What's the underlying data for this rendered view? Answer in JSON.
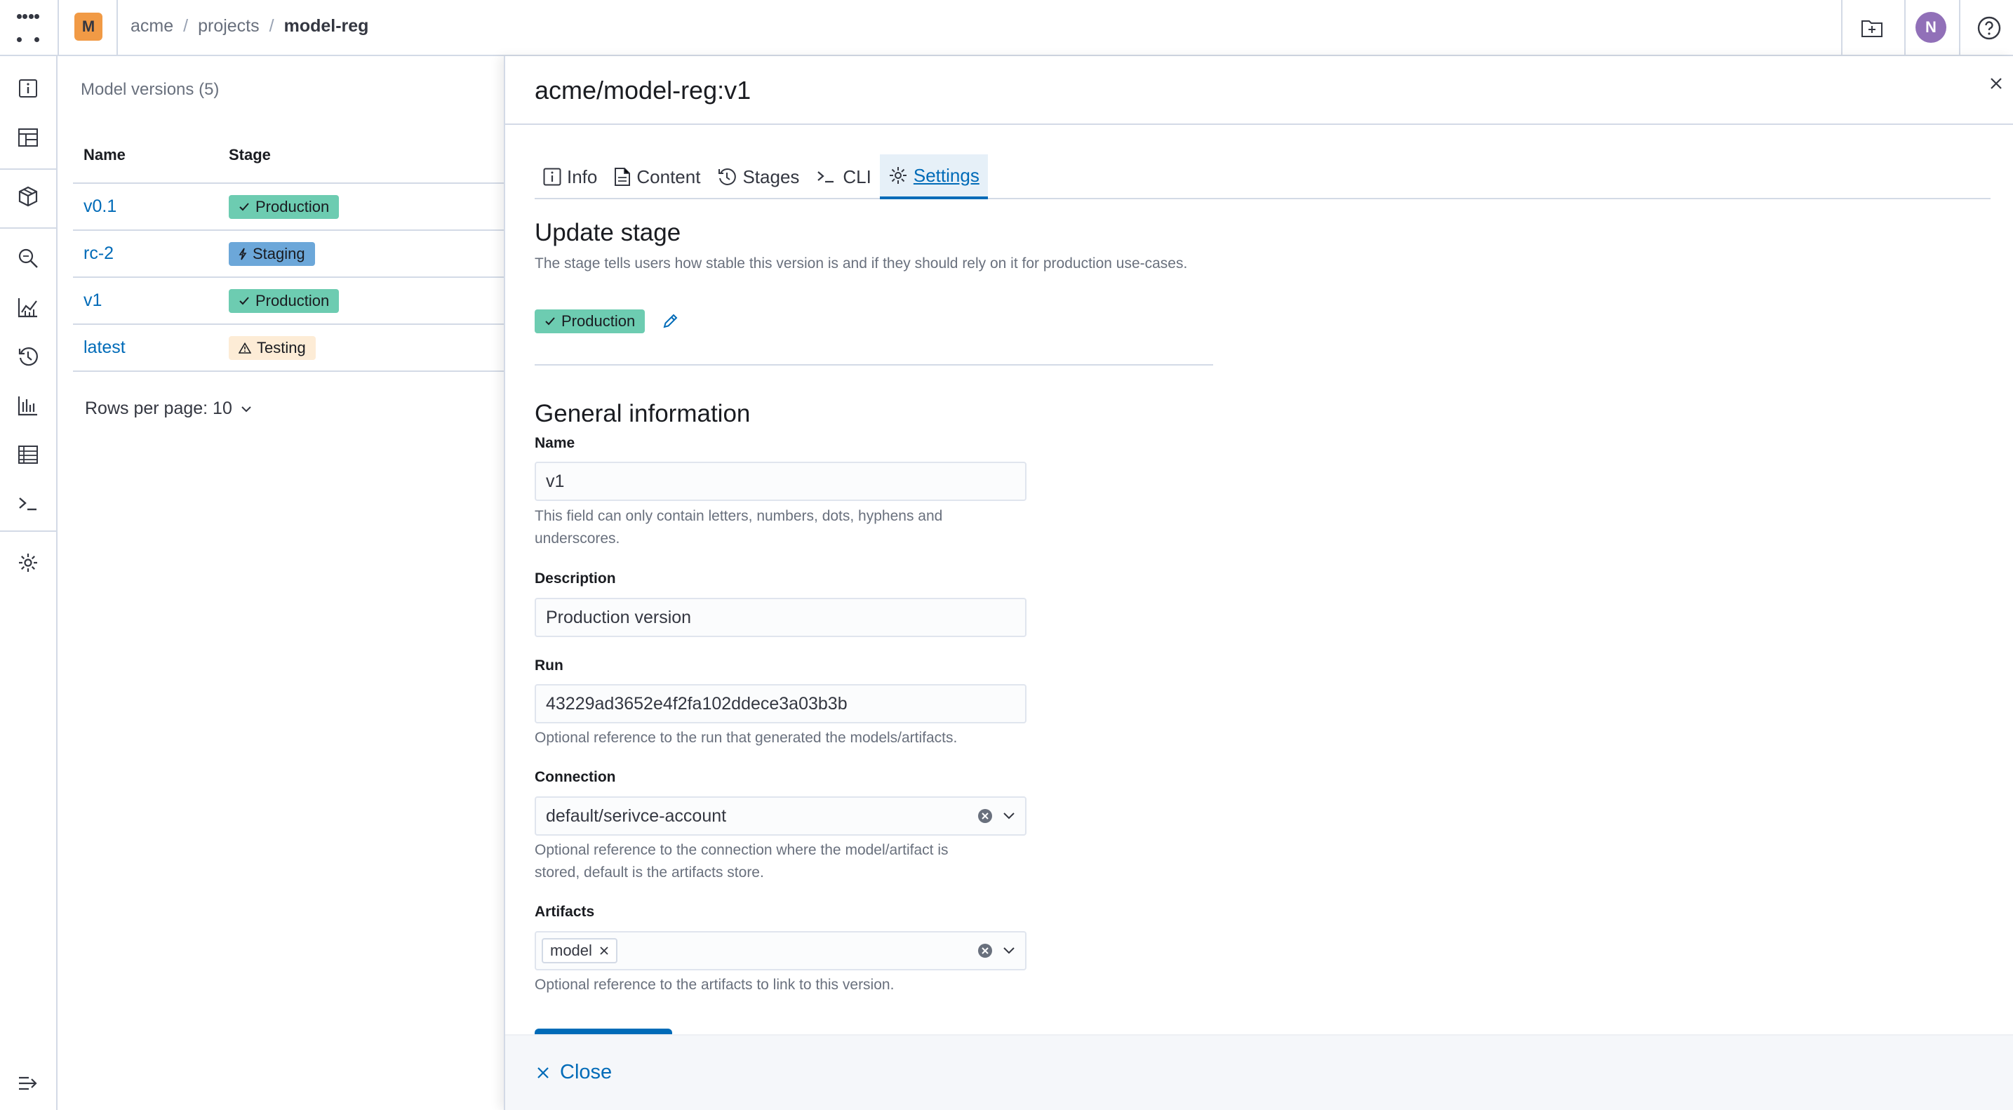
{
  "topbar": {
    "logo_letter": "M",
    "breadcrumb": [
      "acme",
      "projects",
      "model-reg"
    ],
    "breadcrumb_separator": "/",
    "avatar_letter": "N"
  },
  "list": {
    "title": "Model versions (5)",
    "columns": [
      "Name",
      "Stage"
    ],
    "rows": [
      {
        "name": "v0.1",
        "stage": "Production",
        "stage_icon": "check-icon"
      },
      {
        "name": "rc-2",
        "stage": "Staging",
        "stage_icon": "bolt-icon"
      },
      {
        "name": "v1",
        "stage": "Production",
        "stage_icon": "check-icon"
      },
      {
        "name": "latest",
        "stage": "Testing",
        "stage_icon": "warning-icon"
      }
    ],
    "rows_per_page": "Rows per page: 10"
  },
  "flyout": {
    "title": "acme/model-reg:v1",
    "tabs": [
      {
        "label": "Info",
        "icon": "info-icon"
      },
      {
        "label": "Content",
        "icon": "document-icon"
      },
      {
        "label": "Stages",
        "icon": "history-icon"
      },
      {
        "label": "CLI",
        "icon": "terminal-icon"
      },
      {
        "label": "Settings",
        "icon": "gear-icon",
        "active": true
      }
    ],
    "update_stage": {
      "heading": "Update stage",
      "help": "The stage tells users how stable this version is and if they should rely on it for production use-cases.",
      "current_stage": "Production"
    },
    "general": {
      "heading": "General information",
      "name_label": "Name",
      "name_value": "v1",
      "name_help_1": "This field can only contain letters, numbers, dots, hyphens and",
      "name_help_2": "underscores.",
      "description_label": "Description",
      "description_value": "Production version",
      "run_label": "Run",
      "run_value": "43229ad3652e4f2fa102ddece3a03b3b",
      "run_help": "Optional reference to the run that generated the models/artifacts.",
      "connection_label": "Connection",
      "connection_value": "default/serivce-account",
      "connection_help_1": "Optional reference to the connection where the model/artifact is",
      "connection_help_2": "stored, default is the artifacts store.",
      "artifacts_label": "Artifacts",
      "artifacts_chip": "model",
      "artifacts_help": "Optional reference to the artifacts to link to this version."
    },
    "footer_close": "Close"
  },
  "colors": {
    "primary": "#006bb8",
    "production": "#6dccb1",
    "staging": "#6ca7d9",
    "testing": "#fdecd6",
    "logo": "#f19a45",
    "avatar": "#9170b8"
  }
}
